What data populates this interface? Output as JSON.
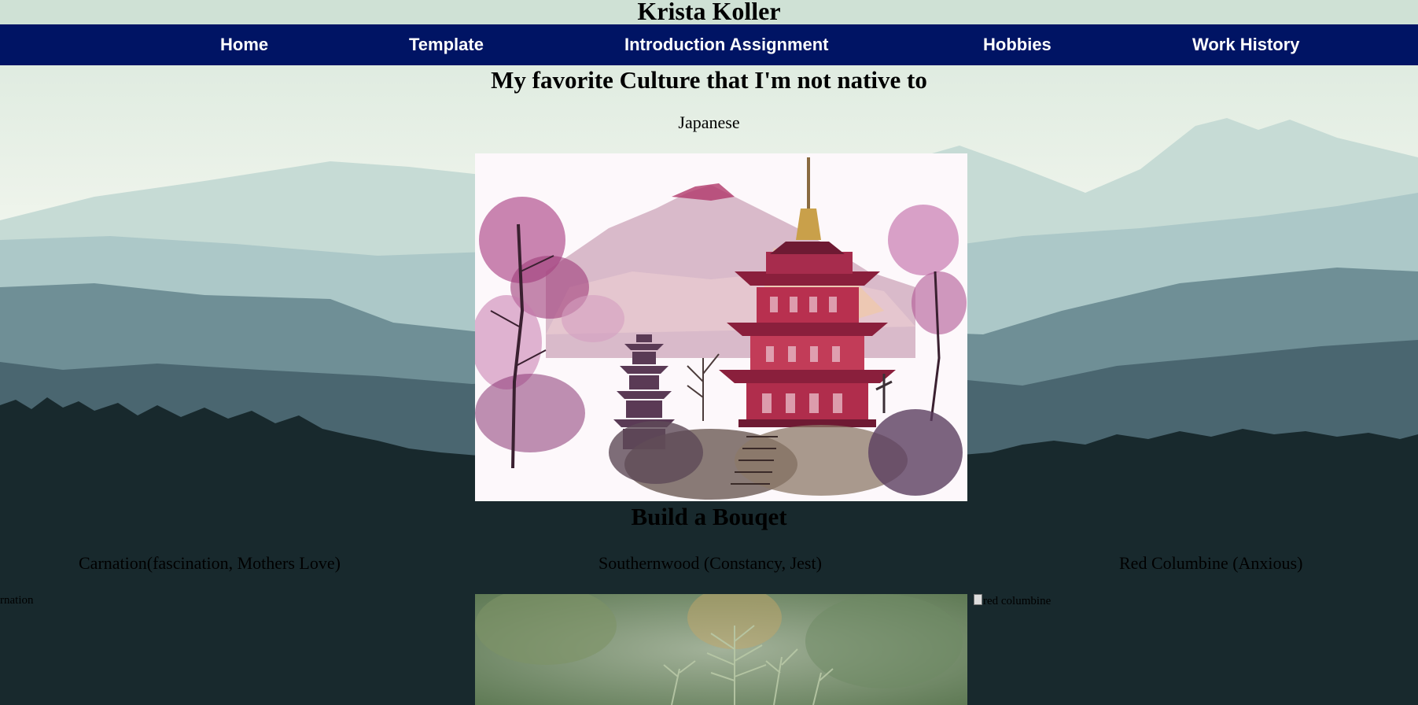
{
  "site_title": "Krista Koller",
  "nav": {
    "items": [
      {
        "label": "Home"
      },
      {
        "label": "Template"
      },
      {
        "label": "Introduction Assignment"
      },
      {
        "label": "Hobbies"
      },
      {
        "label": "Work History"
      }
    ]
  },
  "culture_section": {
    "heading": "My favorite Culture that I'm not native to",
    "culture": "Japanese"
  },
  "bouquet_section": {
    "heading": "Build a Bouqet",
    "flowers": [
      {
        "label": "Carnation(fascination, Mothers Love)",
        "alt_text": "rnation"
      },
      {
        "label": "Southernwood (Constancy, Jest)"
      },
      {
        "label": "Red Columbine (Anxious)",
        "alt_text": "red columbine"
      }
    ]
  },
  "colors": {
    "nav_background": "#001464",
    "title_background": "#cfe1d5",
    "forest": "#18292d"
  }
}
